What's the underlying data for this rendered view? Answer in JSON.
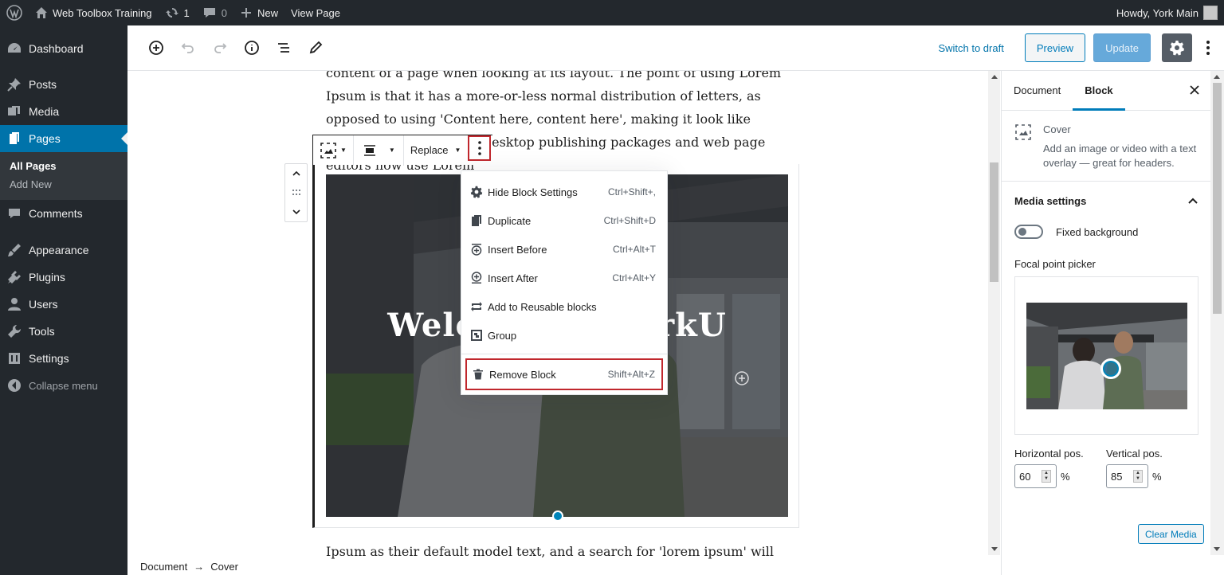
{
  "adminbar": {
    "site_name": "Web Toolbox Training",
    "updates_count": "1",
    "comments_count": "0",
    "new_label": "New",
    "view_page_label": "View Page",
    "howdy": "Howdy, York Main"
  },
  "sidebar": {
    "items": [
      {
        "label": "Dashboard",
        "icon": "dashboard-icon"
      },
      {
        "label": "Posts",
        "icon": "pushpin-icon"
      },
      {
        "label": "Media",
        "icon": "media-icon"
      },
      {
        "label": "Pages",
        "icon": "pages-icon"
      },
      {
        "label": "Comments",
        "icon": "comments-icon"
      },
      {
        "label": "Appearance",
        "icon": "brush-icon"
      },
      {
        "label": "Plugins",
        "icon": "plugins-icon"
      },
      {
        "label": "Users",
        "icon": "users-icon"
      },
      {
        "label": "Tools",
        "icon": "wrench-icon"
      },
      {
        "label": "Settings",
        "icon": "settings-icon"
      }
    ],
    "submenu": [
      "All Pages",
      "Add New"
    ],
    "collapse": "Collapse menu"
  },
  "header": {
    "switch_to_draft": "Switch to draft",
    "preview": "Preview",
    "update": "Update"
  },
  "content": {
    "para_top": "content of a page when looking at its layout. The point of using Lorem Ipsum is that it has a more-or-less normal distribution of letters, as opposed to using 'Content here, content here', making it look like readable English. Many desktop publishing packages and web page editors now use Lorem",
    "cover_title": "Welcome to YorkU",
    "para_bottom": "Ipsum as their default model text, and a search for 'lorem ipsum' will"
  },
  "block_toolbar": {
    "replace": "Replace"
  },
  "block_menu": {
    "items": [
      {
        "label": "Hide Block Settings",
        "shortcut": "Ctrl+Shift+,",
        "icon": "gear-icon"
      },
      {
        "label": "Duplicate",
        "shortcut": "Ctrl+Shift+D",
        "icon": "duplicate-icon"
      },
      {
        "label": "Insert Before",
        "shortcut": "Ctrl+Alt+T",
        "icon": "insert-before-icon"
      },
      {
        "label": "Insert After",
        "shortcut": "Ctrl+Alt+Y",
        "icon": "insert-after-icon"
      },
      {
        "label": "Add to Reusable blocks",
        "shortcut": "",
        "icon": "reusable-icon"
      },
      {
        "label": "Group",
        "shortcut": "",
        "icon": "group-icon"
      }
    ],
    "remove": {
      "label": "Remove Block",
      "shortcut": "Shift+Alt+Z"
    }
  },
  "breadcrumb": {
    "root": "Document",
    "arrow": "→",
    "current": "Cover"
  },
  "settings": {
    "tab_document": "Document",
    "tab_block": "Block",
    "block_name": "Cover",
    "block_desc": "Add an image or video with a text overlay — great for headers.",
    "media_settings": "Media settings",
    "fixed_background": "Fixed background",
    "focal_point_picker": "Focal point picker",
    "horizontal_label": "Horizontal pos.",
    "horizontal_value": "60",
    "vertical_label": "Vertical pos.",
    "vertical_value": "85",
    "percent": "%",
    "clear_media": "Clear Media"
  },
  "colors": {
    "admin_bg": "#23282d",
    "accent": "#0073aa",
    "highlight_red": "#c0272d"
  }
}
